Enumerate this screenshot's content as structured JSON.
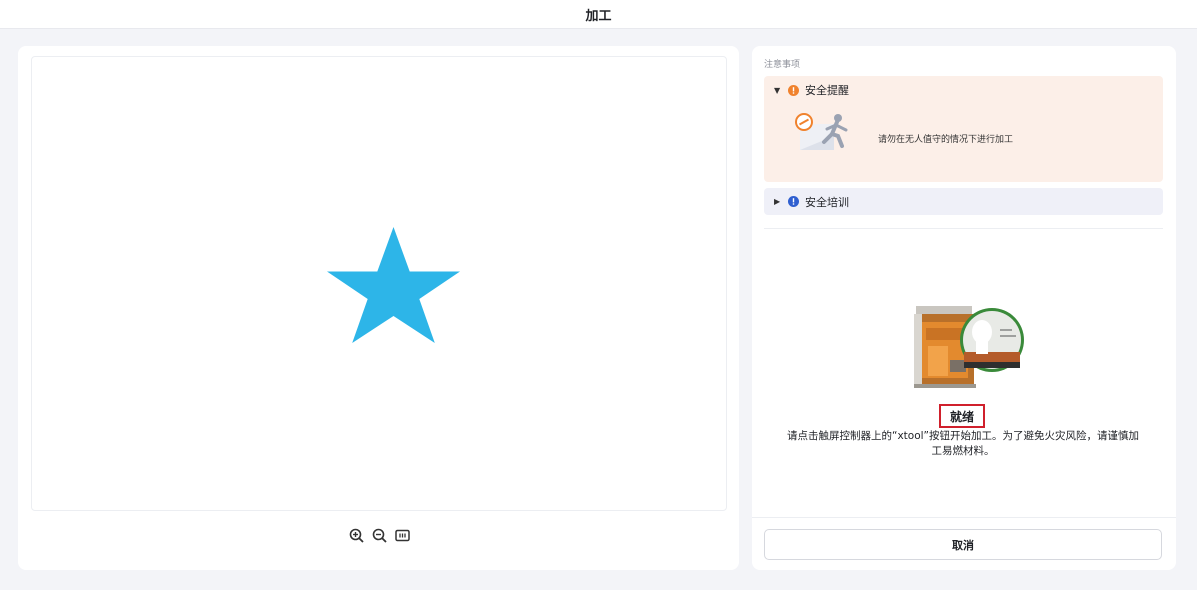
{
  "window": {
    "title": "加工"
  },
  "notice": {
    "section_label": "注意事项",
    "safety": {
      "title": "安全提醒",
      "expanded": true,
      "message": "请勿在无人值守的情况下进行加工",
      "icon": "warning-icon"
    },
    "training": {
      "title": "安全培训",
      "expanded": false,
      "icon": "info-icon"
    }
  },
  "status": {
    "label": "就绪",
    "message": "请点击触屏控制器上的“xtool”按钮开始加工。为了避免火灾风险，请谨慎加工易燃材料。"
  },
  "actions": {
    "cancel_label": "取消"
  },
  "canvas": {
    "shape": "star",
    "shape_color": "#2db5e8",
    "zoom_controls": [
      "zoom-in-icon",
      "zoom-out-icon",
      "fit-screen-icon"
    ]
  },
  "colors": {
    "accent_orange": "#f0822d",
    "info_blue": "#2f5fd0",
    "highlight_red": "#d0202c"
  }
}
